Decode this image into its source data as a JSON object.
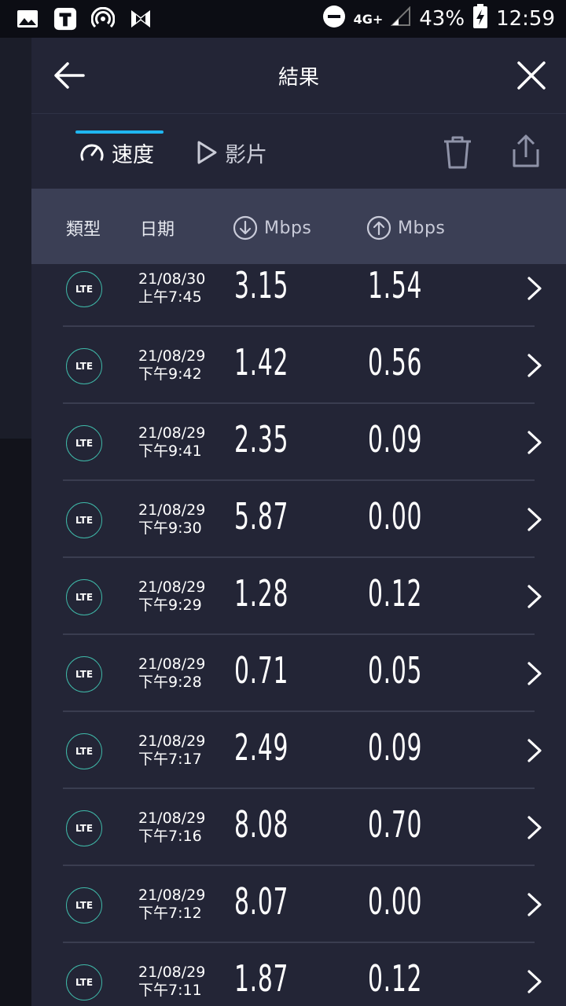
{
  "status_bar": {
    "battery": "43%",
    "time": "12:59",
    "network": "4G+"
  },
  "header": {
    "title": "結果"
  },
  "tabs": {
    "speed": "速度",
    "video": "影片"
  },
  "columns": {
    "type": "類型",
    "date": "日期",
    "download_unit": "Mbps",
    "upload_unit": "Mbps"
  },
  "results": [
    {
      "type": "LTE",
      "date": "21/08/30",
      "time": "上午7:45",
      "download": "3.15",
      "upload": "1.54"
    },
    {
      "type": "LTE",
      "date": "21/08/29",
      "time": "下午9:42",
      "download": "1.42",
      "upload": "0.56"
    },
    {
      "type": "LTE",
      "date": "21/08/29",
      "time": "下午9:41",
      "download": "2.35",
      "upload": "0.09"
    },
    {
      "type": "LTE",
      "date": "21/08/29",
      "time": "下午9:30",
      "download": "5.87",
      "upload": "0.00"
    },
    {
      "type": "LTE",
      "date": "21/08/29",
      "time": "下午9:29",
      "download": "1.28",
      "upload": "0.12"
    },
    {
      "type": "LTE",
      "date": "21/08/29",
      "time": "下午9:28",
      "download": "0.71",
      "upload": "0.05"
    },
    {
      "type": "LTE",
      "date": "21/08/29",
      "time": "下午7:17",
      "download": "2.49",
      "upload": "0.09"
    },
    {
      "type": "LTE",
      "date": "21/08/29",
      "time": "下午7:16",
      "download": "8.08",
      "upload": "0.70"
    },
    {
      "type": "LTE",
      "date": "21/08/29",
      "time": "下午7:12",
      "download": "8.07",
      "upload": "0.00"
    },
    {
      "type": "LTE",
      "date": "21/08/29",
      "time": "下午7:11",
      "download": "1.87",
      "upload": "0.12"
    }
  ],
  "colors": {
    "accent": "#1fb6f0",
    "lte_ring": "#3fb8a8"
  }
}
